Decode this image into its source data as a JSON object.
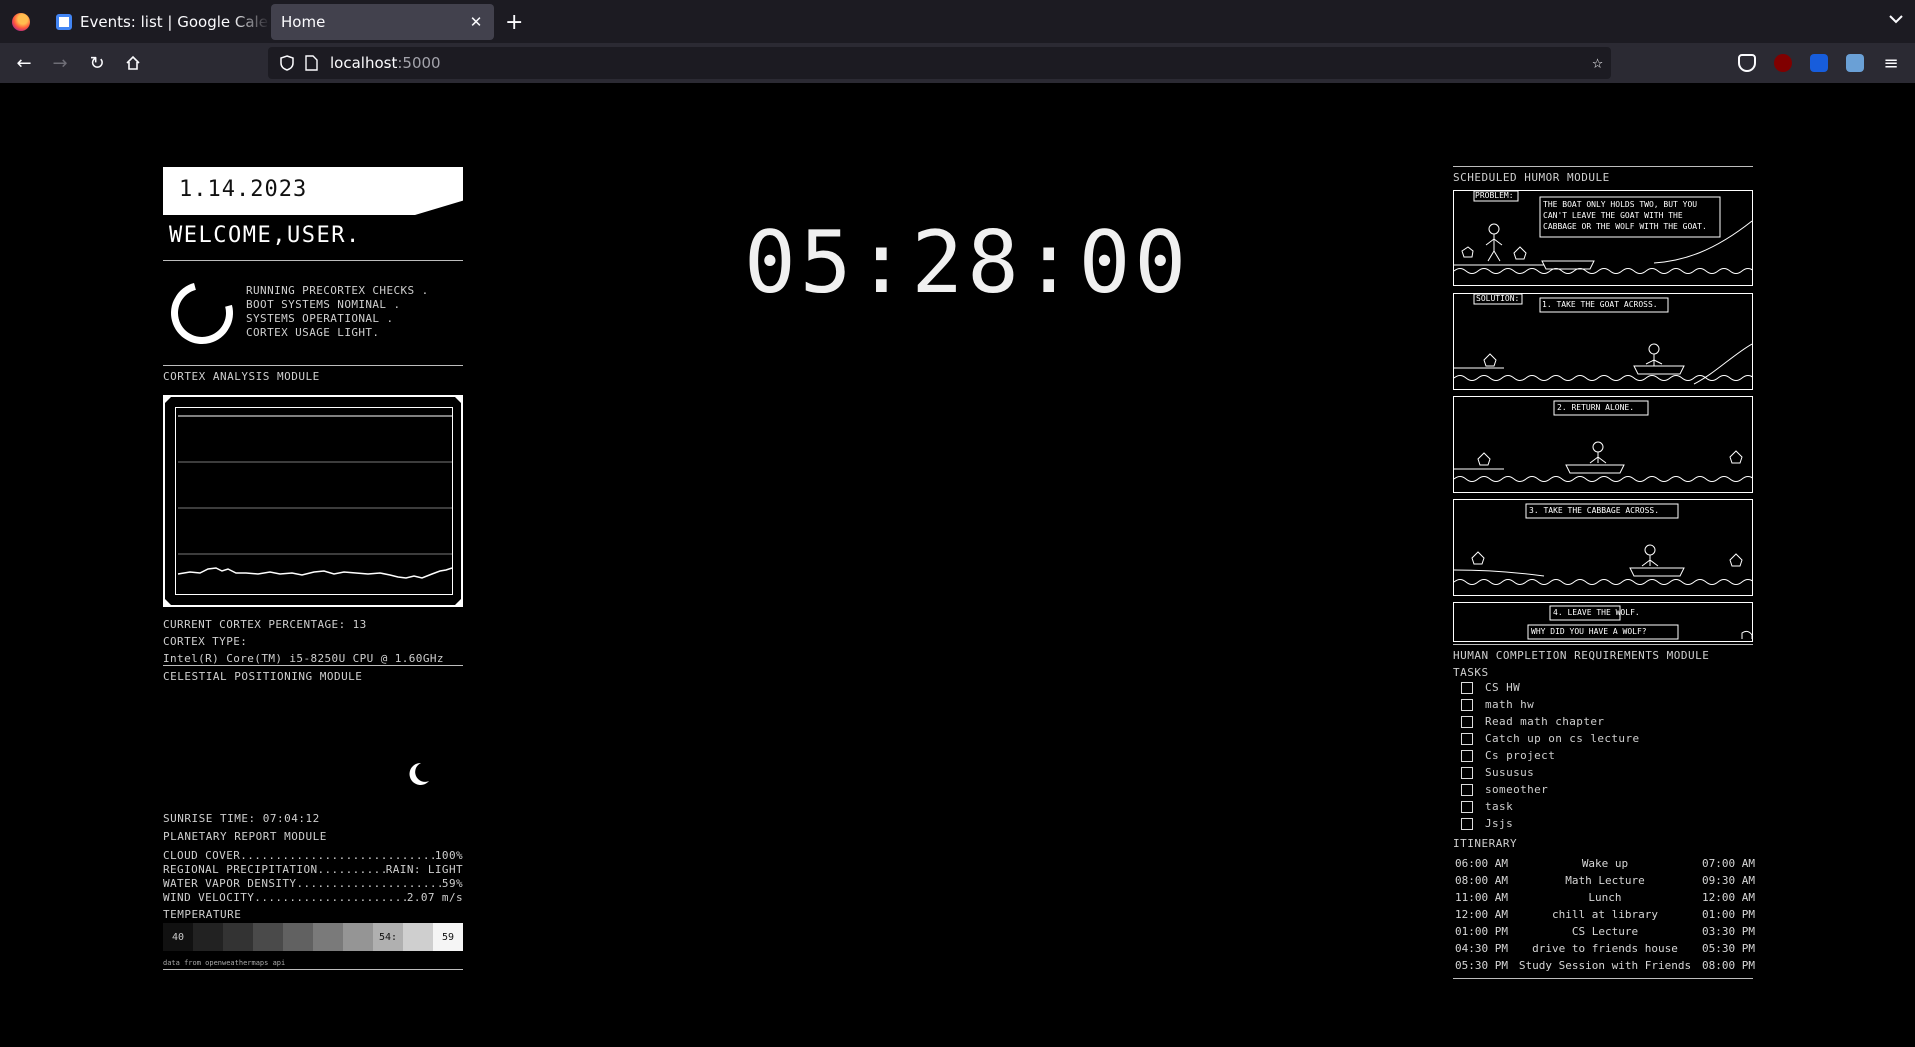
{
  "browser": {
    "tabs": [
      {
        "title": "Events: list | Google Calendar",
        "active": false
      },
      {
        "title": "Home",
        "active": true
      }
    ],
    "url_host": "localhost",
    "url_port": ":5000"
  },
  "dashboard": {
    "date": "1.14.2023",
    "welcome": "WELCOME,USER.",
    "boot_lines": [
      "RUNNING PRECORTEX CHECKS .",
      "BOOT SYSTEMS NOMINAL .",
      "SYSTEMS OPERATIONAL .",
      "CORTEX USAGE LIGHT."
    ],
    "cortex_module_title": "CORTEX ANALYSIS MODULE",
    "cortex_percentage": "CURRENT CORTEX PERCENTAGE: 13",
    "cortex_type_label": "CORTEX TYPE:",
    "cortex_cpu": "Intel(R) Core(TM) i5-8250U CPU @ 1.60GHz",
    "celestial_title": "CELESTIAL POSITIONING MODULE",
    "sunrise": "SUNRISE TIME: 07:04:12",
    "planetary_title": "PLANETARY REPORT MODULE",
    "weather": [
      {
        "label": "CLOUD COVER",
        "value": "100%"
      },
      {
        "label": "REGIONAL PRECIPITATION",
        "value": "RAIN: LIGHT"
      },
      {
        "label": "WATER VAPOR DENSITY",
        "value": "59%"
      },
      {
        "label": "WIND VELOCITY",
        "value": "2.07 m/s"
      }
    ],
    "temperature_title": "TEMPERATURE",
    "temp_low": "40",
    "temp_current": "54:",
    "temp_high": "59",
    "data_source": "data from openweathermaps api",
    "clock": "05:28:00",
    "humor_title": "SCHEDULED HUMOR MODULE",
    "comic_captions": [
      "PROBLEM:",
      "THE BOAT ONLY HOLDS TWO, BUT YOU CAN'T LEAVE THE GOAT WITH THE CABBAGE OR THE WOLF WITH THE GOAT.",
      "SOLUTION:",
      "1. TAKE THE GOAT ACROSS.",
      "2. RETURN ALONE.",
      "3. TAKE THE CABBAGE ACROSS.",
      "4. LEAVE THE WOLF.",
      "WHY DID YOU HAVE A WOLF?"
    ],
    "requirements_title": "HUMAN COMPLETION REQUIREMENTS MODULE",
    "tasks_title": "TASKS",
    "tasks": [
      "CS HW",
      "math hw",
      "Read math chapter",
      "Catch up on cs lecture",
      "Cs project",
      "Sususus",
      "someother",
      "task",
      "Jsjs"
    ],
    "itinerary_title": "ITINERARY",
    "itinerary": [
      {
        "start": "06:00 AM",
        "event": "Wake up",
        "end": "07:00 AM"
      },
      {
        "start": "08:00 AM",
        "event": "Math Lecture",
        "end": "09:30 AM"
      },
      {
        "start": "11:00 AM",
        "event": "Lunch",
        "end": "12:00 AM"
      },
      {
        "start": "12:00 AM",
        "event": "chill at library",
        "end": "01:00 PM"
      },
      {
        "start": "01:00 PM",
        "event": "CS Lecture",
        "end": "03:30 PM"
      },
      {
        "start": "04:30 PM",
        "event": "drive to friends house",
        "end": "05:30 PM"
      },
      {
        "start": "05:30 PM",
        "event": "Study Session with Friends",
        "end": "08:00 PM"
      }
    ]
  }
}
